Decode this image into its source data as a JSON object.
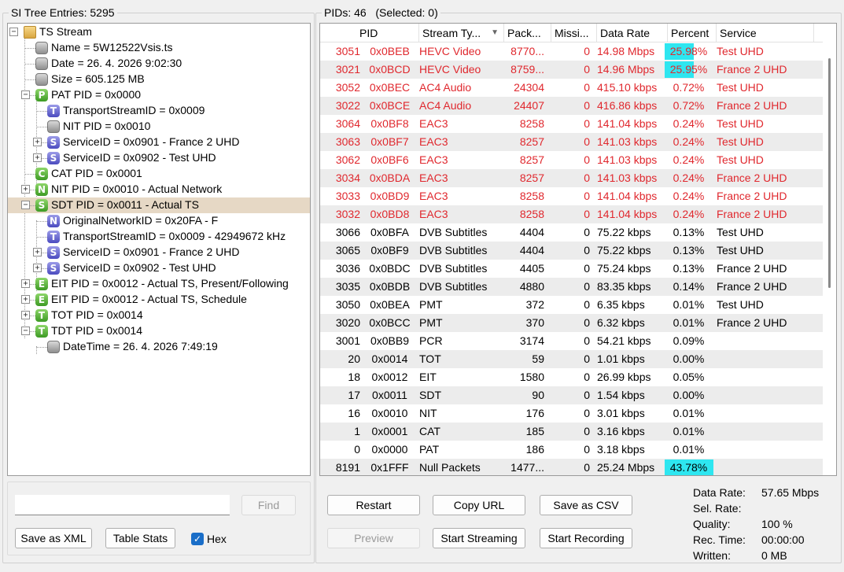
{
  "tree": {
    "title": "SI Tree Entries: 5295",
    "nodes": [
      {
        "label": "TS Stream",
        "icon": "folder",
        "letter": ""
      },
      {
        "label": "Name = 5W12522Vsis.ts",
        "icon": "gray",
        "letter": ""
      },
      {
        "label": "Date = 26. 4. 2026 9:02:30",
        "icon": "gray",
        "letter": ""
      },
      {
        "label": "Size = 605.125 MB",
        "icon": "gray",
        "letter": ""
      },
      {
        "label": "PAT PID = 0x0000",
        "icon": "P",
        "letter": "P"
      },
      {
        "label": "TransportStreamID = 0x0009",
        "icon": "T",
        "letter": "T"
      },
      {
        "label": "NIT PID = 0x0010",
        "icon": "gray",
        "letter": ""
      },
      {
        "label": "ServiceID = 0x0901 - France 2 UHD",
        "icon": "S",
        "letter": "S"
      },
      {
        "label": "ServiceID = 0x0902 - Test UHD",
        "icon": "S",
        "letter": "S"
      },
      {
        "label": "CAT PID = 0x0001",
        "icon": "C",
        "letter": "C"
      },
      {
        "label": "NIT PID = 0x0010 - Actual Network",
        "icon": "Ng",
        "letter": "N"
      },
      {
        "label": "SDT PID = 0x0011 - Actual TS",
        "icon": "Sg",
        "letter": "S"
      },
      {
        "label": "OriginalNetworkID = 0x20FA - F",
        "icon": "N",
        "letter": "N"
      },
      {
        "label": "TransportStreamID = 0x0009 - 42949672 kHz",
        "icon": "T",
        "letter": "T"
      },
      {
        "label": "ServiceID = 0x0901 - France 2 UHD",
        "icon": "S",
        "letter": "S"
      },
      {
        "label": "ServiceID = 0x0902 - Test UHD",
        "icon": "S",
        "letter": "S"
      },
      {
        "label": "EIT PID = 0x0012 - Actual TS, Present/Following",
        "icon": "E",
        "letter": "E"
      },
      {
        "label": "EIT PID = 0x0012 - Actual TS, Schedule",
        "icon": "E",
        "letter": "E"
      },
      {
        "label": "TOT PID = 0x0014",
        "icon": "Tg",
        "letter": "T"
      },
      {
        "label": "TDT PID = 0x0014",
        "icon": "Tg",
        "letter": "T"
      },
      {
        "label": "DateTime = 26. 4. 2026 7:49:19",
        "icon": "gray",
        "letter": ""
      }
    ]
  },
  "pids": {
    "title": "PIDs: 46",
    "selected": "(Selected: 0)",
    "columns": [
      "PID",
      "",
      "Stream Ty...",
      "Pack...",
      "Missi...",
      "Data Rate",
      "Percent",
      "Service"
    ],
    "rows": [
      {
        "dec": "3051",
        "hex": "0x0BEB",
        "type": "HEVC Video",
        "packets": "8770...",
        "missing": "0",
        "rate": "14.98 Mbps",
        "pct": "25.98%",
        "pct_value": 25.98,
        "service": "Test UHD",
        "red": true
      },
      {
        "dec": "3021",
        "hex": "0x0BCD",
        "type": "HEVC Video",
        "packets": "8759...",
        "missing": "0",
        "rate": "14.96 Mbps",
        "pct": "25.95%",
        "pct_value": 25.95,
        "service": "France 2 UHD",
        "red": true
      },
      {
        "dec": "3052",
        "hex": "0x0BEC",
        "type": "AC4 Audio",
        "packets": "24304",
        "missing": "0",
        "rate": "415.10 kbps",
        "pct": "0.72%",
        "pct_value": 0.72,
        "service": "Test UHD",
        "red": true
      },
      {
        "dec": "3022",
        "hex": "0x0BCE",
        "type": "AC4 Audio",
        "packets": "24407",
        "missing": "0",
        "rate": "416.86 kbps",
        "pct": "0.72%",
        "pct_value": 0.72,
        "service": "France 2 UHD",
        "red": true
      },
      {
        "dec": "3064",
        "hex": "0x0BF8",
        "type": "EAC3",
        "packets": "8258",
        "missing": "0",
        "rate": "141.04 kbps",
        "pct": "0.24%",
        "pct_value": 0.24,
        "service": "Test UHD",
        "red": true
      },
      {
        "dec": "3063",
        "hex": "0x0BF7",
        "type": "EAC3",
        "packets": "8257",
        "missing": "0",
        "rate": "141.03 kbps",
        "pct": "0.24%",
        "pct_value": 0.24,
        "service": "Test UHD",
        "red": true
      },
      {
        "dec": "3062",
        "hex": "0x0BF6",
        "type": "EAC3",
        "packets": "8257",
        "missing": "0",
        "rate": "141.03 kbps",
        "pct": "0.24%",
        "pct_value": 0.24,
        "service": "Test UHD",
        "red": true
      },
      {
        "dec": "3034",
        "hex": "0x0BDA",
        "type": "EAC3",
        "packets": "8257",
        "missing": "0",
        "rate": "141.03 kbps",
        "pct": "0.24%",
        "pct_value": 0.24,
        "service": "France 2 UHD",
        "red": true
      },
      {
        "dec": "3033",
        "hex": "0x0BD9",
        "type": "EAC3",
        "packets": "8258",
        "missing": "0",
        "rate": "141.04 kbps",
        "pct": "0.24%",
        "pct_value": 0.24,
        "service": "France 2 UHD",
        "red": true
      },
      {
        "dec": "3032",
        "hex": "0x0BD8",
        "type": "EAC3",
        "packets": "8258",
        "missing": "0",
        "rate": "141.04 kbps",
        "pct": "0.24%",
        "pct_value": 0.24,
        "service": "France 2 UHD",
        "red": true
      },
      {
        "dec": "3066",
        "hex": "0x0BFA",
        "type": "DVB Subtitles",
        "packets": "4404",
        "missing": "0",
        "rate": "75.22 kbps",
        "pct": "0.13%",
        "pct_value": 0.13,
        "service": "Test UHD",
        "red": false
      },
      {
        "dec": "3065",
        "hex": "0x0BF9",
        "type": "DVB Subtitles",
        "packets": "4404",
        "missing": "0",
        "rate": "75.22 kbps",
        "pct": "0.13%",
        "pct_value": 0.13,
        "service": "Test UHD",
        "red": false
      },
      {
        "dec": "3036",
        "hex": "0x0BDC",
        "type": "DVB Subtitles",
        "packets": "4405",
        "missing": "0",
        "rate": "75.24 kbps",
        "pct": "0.13%",
        "pct_value": 0.13,
        "service": "France 2 UHD",
        "red": false
      },
      {
        "dec": "3035",
        "hex": "0x0BDB",
        "type": "DVB Subtitles",
        "packets": "4880",
        "missing": "0",
        "rate": "83.35 kbps",
        "pct": "0.14%",
        "pct_value": 0.14,
        "service": "France 2 UHD",
        "red": false
      },
      {
        "dec": "3050",
        "hex": "0x0BEA",
        "type": "PMT",
        "packets": "372",
        "missing": "0",
        "rate": "6.35 kbps",
        "pct": "0.01%",
        "pct_value": 0.01,
        "service": "Test UHD",
        "red": false
      },
      {
        "dec": "3020",
        "hex": "0x0BCC",
        "type": "PMT",
        "packets": "370",
        "missing": "0",
        "rate": "6.32 kbps",
        "pct": "0.01%",
        "pct_value": 0.01,
        "service": "France 2 UHD",
        "red": false
      },
      {
        "dec": "3001",
        "hex": "0x0BB9",
        "type": "PCR",
        "packets": "3174",
        "missing": "0",
        "rate": "54.21 kbps",
        "pct": "0.09%",
        "pct_value": 0.09,
        "service": "",
        "red": false
      },
      {
        "dec": "20",
        "hex": "0x0014",
        "type": "TOT",
        "packets": "59",
        "missing": "0",
        "rate": "1.01 kbps",
        "pct": "0.00%",
        "pct_value": 0.0,
        "service": "",
        "red": false
      },
      {
        "dec": "18",
        "hex": "0x0012",
        "type": "EIT",
        "packets": "1580",
        "missing": "0",
        "rate": "26.99 kbps",
        "pct": "0.05%",
        "pct_value": 0.05,
        "service": "",
        "red": false
      },
      {
        "dec": "17",
        "hex": "0x0011",
        "type": "SDT",
        "packets": "90",
        "missing": "0",
        "rate": "1.54 kbps",
        "pct": "0.00%",
        "pct_value": 0.0,
        "service": "",
        "red": false
      },
      {
        "dec": "16",
        "hex": "0x0010",
        "type": "NIT",
        "packets": "176",
        "missing": "0",
        "rate": "3.01 kbps",
        "pct": "0.01%",
        "pct_value": 0.01,
        "service": "",
        "red": false
      },
      {
        "dec": "1",
        "hex": "0x0001",
        "type": "CAT",
        "packets": "185",
        "missing": "0",
        "rate": "3.16 kbps",
        "pct": "0.01%",
        "pct_value": 0.01,
        "service": "",
        "red": false
      },
      {
        "dec": "0",
        "hex": "0x0000",
        "type": "PAT",
        "packets": "186",
        "missing": "0",
        "rate": "3.18 kbps",
        "pct": "0.01%",
        "pct_value": 0.01,
        "service": "",
        "red": false
      },
      {
        "dec": "8191",
        "hex": "0x1FFF",
        "type": "Null Packets",
        "packets": "1477...",
        "missing": "0",
        "rate": "25.24 Mbps",
        "pct": "43.78%",
        "pct_value": 43.78,
        "service": "",
        "red": false
      }
    ]
  },
  "search": {
    "value": "",
    "find_label": "Find"
  },
  "left_buttons": {
    "save_xml": "Save as XML",
    "table_stats": "Table Stats",
    "hex_label": "Hex",
    "hex_checked": true
  },
  "right_buttons": {
    "restart": "Restart",
    "copy_url": "Copy URL",
    "save_csv": "Save as CSV",
    "preview": "Preview",
    "start_streaming": "Start Streaming",
    "start_recording": "Start Recording"
  },
  "stats": {
    "data_rate_label": "Data Rate:",
    "data_rate": "57.65 Mbps",
    "sel_rate_label": "Sel. Rate:",
    "sel_rate": "",
    "quality_label": "Quality:",
    "quality": "100 %",
    "rec_time_label": "Rec. Time:",
    "rec_time": "00:00:00",
    "written_label": "Written:",
    "written": "0 MB"
  },
  "colors": {
    "highlight_red": "#e0282e",
    "percent_bar": "#2ee6f0",
    "selected_row": "#e6d8c5"
  }
}
